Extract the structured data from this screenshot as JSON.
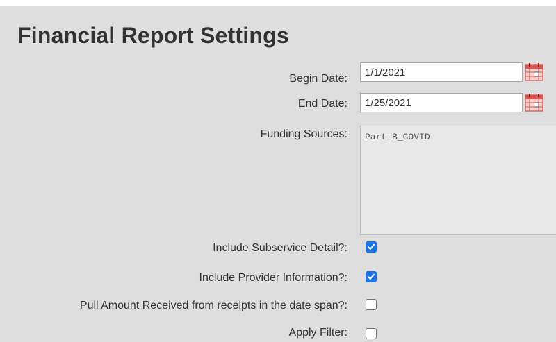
{
  "title": "Financial Report Settings",
  "begin_date": {
    "label": "Begin Date:",
    "value": "1/1/2021"
  },
  "end_date": {
    "label": "End Date:",
    "value": "1/25/2021"
  },
  "funding_sources": {
    "label": "Funding Sources:",
    "options": [
      "Part B_COVID"
    ]
  },
  "options": {
    "subservice": {
      "label": "Include Subservice Detail?:",
      "checked": true
    },
    "provider": {
      "label": "Include Provider Information?:",
      "checked": true
    },
    "receipts": {
      "label": "Pull Amount Received from receipts in the date span?:",
      "checked": false
    },
    "filter": {
      "label": "Apply Filter:",
      "checked": false
    }
  },
  "colors": {
    "panel_background": "#dedede",
    "checkbox_accent": "#1a73e8",
    "calendar_icon": "#d9534f"
  },
  "icons": {
    "calendar": "calendar-icon"
  }
}
